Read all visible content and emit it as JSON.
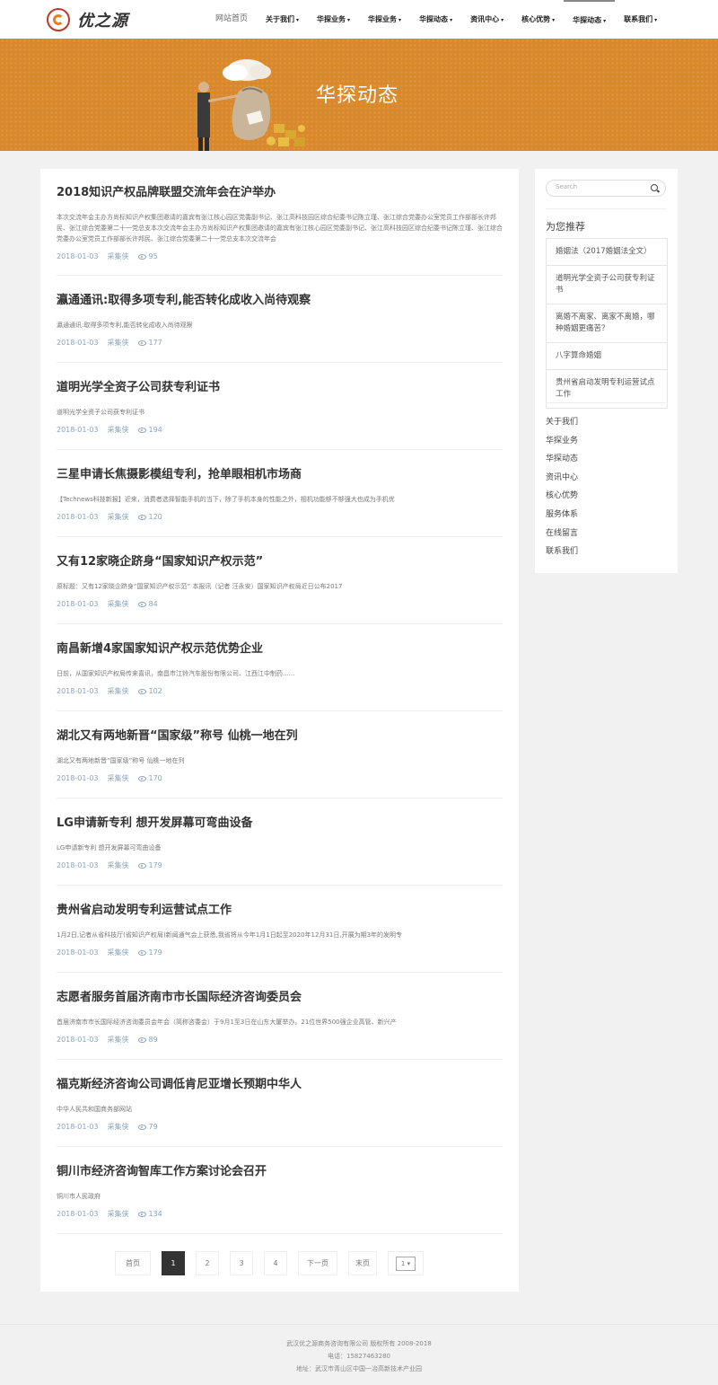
{
  "header": {
    "logo_text": "优之源",
    "nav": [
      {
        "label": "网站首页",
        "caret": ""
      },
      {
        "label": "关于我们",
        "caret": "▾"
      },
      {
        "label": "华探业务",
        "caret": "▾"
      },
      {
        "label": "华探业务",
        "caret": "▾"
      },
      {
        "label": "华探动态",
        "caret": "▾"
      },
      {
        "label": "资讯中心",
        "caret": "▾"
      },
      {
        "label": "核心优势",
        "caret": "▾"
      },
      {
        "label": "华探动态",
        "caret": "▾"
      },
      {
        "label": "联系我们",
        "caret": "▾"
      }
    ]
  },
  "banner": {
    "title": "华探动态"
  },
  "articles": [
    {
      "title": "2018知识产权品牌联盟交流年会在沪举办",
      "desc": "本次交流年会主办方尚标知识产权集团邀请的嘉宾有张江核心园区党委副书记、张江高科技园区综合纪委书记陈立瑾、张江综合党委办公室党员工作部部长许邦民、张江综合党委第二十一党总支本次交流年会主办方尚标知识产权集团邀请的嘉宾有张江核心园区党委副书记、张江高科技园区综合纪委书记陈立瑾、张江综合党委办公室党员工作部部长许邦民、张江综合党委第二十一党总支本次交流年会",
      "date": "2018-01-03",
      "author": "采集侠",
      "views": "95"
    },
    {
      "title": "瀛通通讯:取得多项专利,能否转化成收入尚待观察",
      "desc": "瀛通通讯:取得多项专利,能否转化成收入尚待观察",
      "date": "2018-01-03",
      "author": "采集侠",
      "views": "177"
    },
    {
      "title": "道明光学全资子公司获专利证书",
      "desc": "道明光学全资子公司获专利证书",
      "date": "2018-01-03",
      "author": "采集侠",
      "views": "194"
    },
    {
      "title": "三星申请长焦摄影模组专利，抢单眼相机市场商",
      "desc": "【Technews科技新报】近来，消费者选择智能手机的当下，除了手机本身的性能之外，相机功能够不够强大也成为手机优",
      "date": "2018-01-03",
      "author": "采集侠",
      "views": "120"
    },
    {
      "title": "又有12家晓企跻身“国家知识产权示范”",
      "desc": "原标题：又有12家晓企跻身“国家知识产权示范” 本报讯（记者 汪永安）国家知识产权局近日公布2017",
      "date": "2018-01-03",
      "author": "采集侠",
      "views": "84"
    },
    {
      "title": "南昌新增4家国家知识产权示范优势企业",
      "desc": "日前，从国家知识产权局传来喜讯，南昌市江铃汽车股份有限公司、江西江中制药......",
      "date": "2018-01-03",
      "author": "采集侠",
      "views": "102"
    },
    {
      "title": "湖北又有两地新晋“国家级”称号 仙桃一地在列",
      "desc": "湖北又有两地新晋“国家级”称号 仙桃一地在列",
      "date": "2018-01-03",
      "author": "采集侠",
      "views": "170"
    },
    {
      "title": "LG申请新专利 想开发屏幕可弯曲设备",
      "desc": "LG申请新专利 想开发屏幕可弯曲设备",
      "date": "2018-01-03",
      "author": "采集侠",
      "views": "179"
    },
    {
      "title": "贵州省启动发明专利运营试点工作",
      "desc": "1月2日,记者从省科技厅(省知识产权局)新闻通气会上获悉,我省将从今年1月1日起至2020年12月31日,开展为期3年的发明专",
      "date": "2018-01-03",
      "author": "采集侠",
      "views": "179"
    },
    {
      "title": "志愿者服务首届济南市市长国际经济咨询委员会",
      "desc": "首届济南市市长国际经济咨询委员会年会（简称咨委会）于9月1至3日在山东大厦举办。21位世界500强企业高管、新兴产",
      "date": "2018-01-03",
      "author": "采集侠",
      "views": "89"
    },
    {
      "title": "福克斯经济咨询公司调低肯尼亚增长预期中华人",
      "desc": "中华人民共和国商务部网站",
      "date": "2018-01-03",
      "author": "采集侠",
      "views": "79"
    },
    {
      "title": "铜川市经济咨询智库工作方案讨论会召开",
      "desc": "铜川市人民政府",
      "date": "2018-01-03",
      "author": "采集侠",
      "views": "134"
    }
  ],
  "pagination": {
    "first": "首页",
    "pages": [
      "1",
      "2",
      "3",
      "4"
    ],
    "next": "下一页",
    "last": "末页",
    "select_value": "1",
    "select_caret": "▾"
  },
  "sidebar": {
    "search_placeholder": "Search",
    "recommend_title": "为您推荐",
    "recommend": [
      "婚姻法（2017婚姻法全文）",
      "道明光学全资子公司获专利证书",
      "离婚不离家、离家不离婚，哪种婚姻更痛苦？",
      "八字算命婚姻",
      "贵州省启动发明专利运营试点工作"
    ],
    "links": [
      "关于我们",
      "华探业务",
      "华探动态",
      "资讯中心",
      "核心优势",
      "服务体系",
      "在线留言",
      "联系我们"
    ]
  },
  "footer": {
    "copyright": "武汉优之源商务咨询有限公司 版权所有 2008-2018",
    "phone": "电话：15827463280",
    "address": "地址：武汉市青山区中国一冶高新技术产业园"
  }
}
